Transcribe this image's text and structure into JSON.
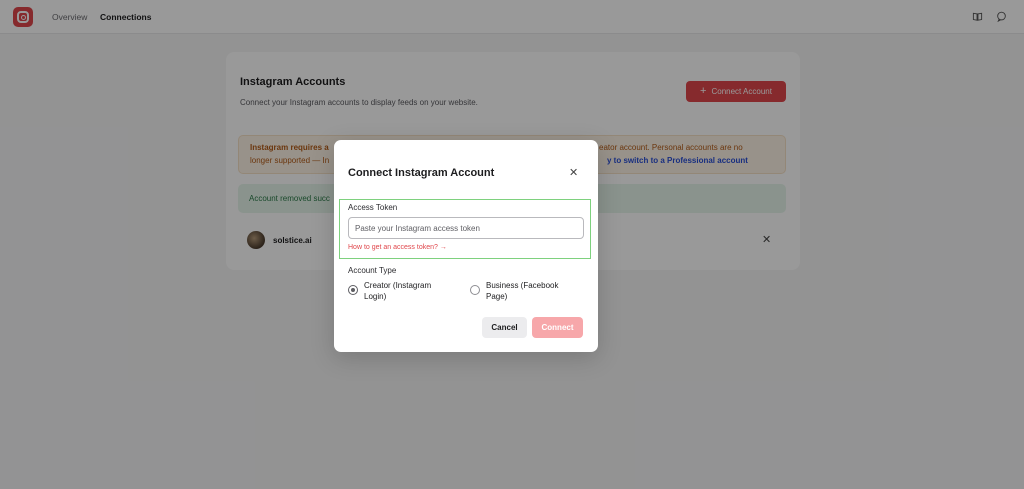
{
  "nav": {
    "logo_icon": "instagram-icon",
    "items": [
      {
        "label": "Overview"
      },
      {
        "label": "Connections"
      }
    ],
    "right_icons": [
      "book-icon",
      "chat-icon"
    ]
  },
  "card": {
    "title": "Instagram Accounts",
    "subtitle": "Connect your Instagram accounts to display feeds on your website.",
    "connect_button": "Connect Account",
    "warning": {
      "bold_text": "Instagram requires a",
      "text_right": "eator account. Personal accounts are no",
      "line2": "longer supported — In",
      "link": "y to switch to a Professional account"
    },
    "success_text": "Account removed succ",
    "account": {
      "name": "solstice.ai"
    }
  },
  "modal": {
    "title": "Connect Instagram Account",
    "access_token_label": "Access Token",
    "access_token_placeholder": "Paste your Instagram access token",
    "access_token_value": "",
    "help_link": "How to get an access token? →",
    "account_type_label": "Account Type",
    "options": [
      {
        "label": "Creator (Instagram Login)",
        "selected": true
      },
      {
        "label": "Business (Facebook Page)",
        "selected": false
      }
    ],
    "cancel_label": "Cancel",
    "connect_label": "Connect"
  },
  "colors": {
    "accent": "#e0474c",
    "accent_disabled": "#f7a7aa",
    "focus_outline": "#7ed17e",
    "warning_text": "#b35a16",
    "success_text": "#2a7a47",
    "link": "#2a4fd6"
  }
}
